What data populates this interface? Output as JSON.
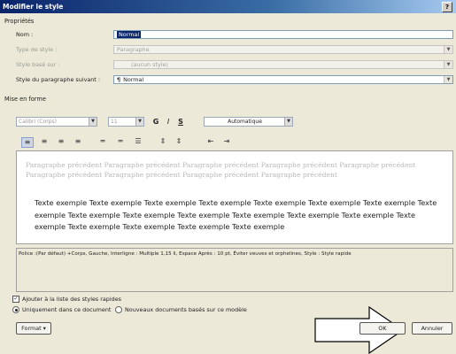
{
  "window": {
    "title": "Modifier le style",
    "help": "?"
  },
  "properties": {
    "section": "Propriétés",
    "name_label": "Nom :",
    "name_value": "Normal",
    "type_label": "Type de style :",
    "type_value": "Paragraphe",
    "based_label": "Style basé sur :",
    "based_value": "(aucun style)",
    "next_label": "Style du paragraphe suivant :",
    "next_value": "Normal",
    "next_icon": "¶"
  },
  "formatting": {
    "section": "Mise en forme",
    "font": "Calibri (Corps)",
    "size": "11",
    "bold": "G",
    "italic": "I",
    "underline": "S",
    "color": "Automatique"
  },
  "preview": {
    "previous": "Paragraphe précédent Paragraphe précédent Paragraphe précédent Paragraphe précédent Paragraphe précédent Paragraphe précédent Paragraphe précédent Paragraphe précédent Paragraphe précédent",
    "sample": "Texte exemple Texte exemple Texte exemple Texte exemple Texte exemple Texte exemple Texte exemple Texte exemple Texte exemple Texte exemple Texte exemple Texte exemple Texte exemple Texte exemple Texte exemple Texte exemple Texte exemple Texte exemple Texte exemple"
  },
  "description": "Police :(Par défaut) +Corps, Gauche, Interligne : Multiple 1,15 li, Espace Après : 10 pt, Éviter veuves et orphelines, Style : Style rapide",
  "options": {
    "add_quick": "Ajouter à la liste des styles rapides",
    "only_doc": "Uniquement dans ce document",
    "new_docs": "Nouveaux documents basés sur ce modèle"
  },
  "buttons": {
    "format": "Format",
    "ok": "OK",
    "cancel": "Annuler"
  }
}
